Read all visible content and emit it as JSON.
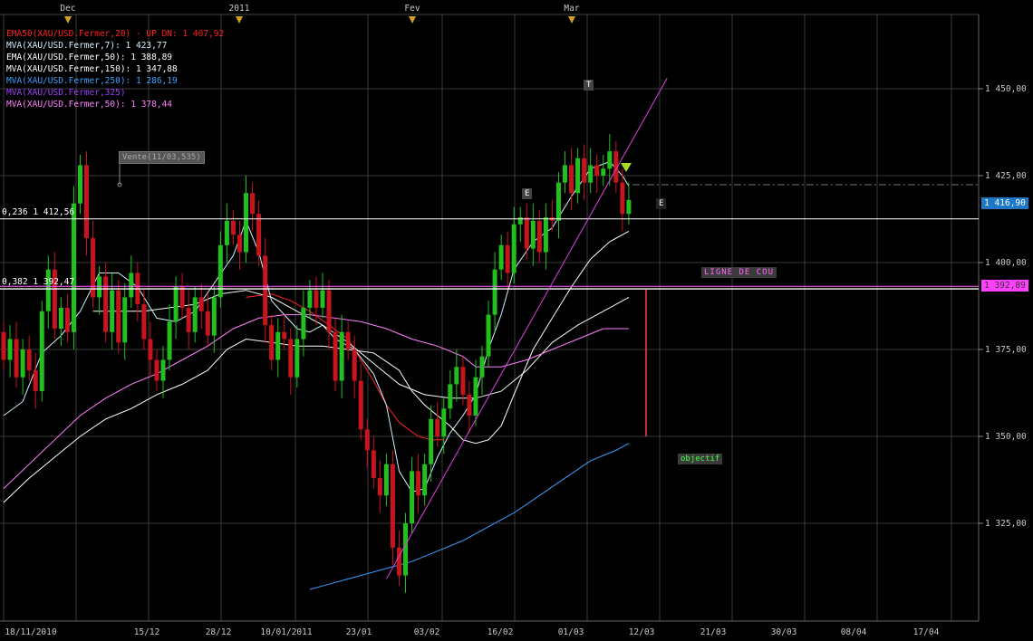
{
  "colors": {
    "background": "#000000",
    "grid": "#3a3a3a",
    "candle_up": "#22c01e",
    "candle_down": "#c8141e",
    "fib_line": "#ffffff",
    "neckline": "#ff66ff",
    "trendline": "#e040e0",
    "ema20": "#ff2020",
    "mva7": "#d0f0ff",
    "ema50": "#f0fff0",
    "mva150": "#ffffff",
    "mva250": "#3aa0ff",
    "mva325": "#9a40ff",
    "mva50": "#ff80ff"
  },
  "legend": [
    {
      "text": "EMA50(XAU/USD.Fermer,20) - UP DN: 1 407,92",
      "color": "#ff2020",
      "name": "legend-ema20"
    },
    {
      "text": "MVA(XAU/USD.Fermer,7): 1 423,77",
      "color": "#d0f0ff",
      "name": "legend-mva7"
    },
    {
      "text": "EMA(XAU/USD.Fermer,50): 1 388,89",
      "color": "#ffffff",
      "name": "legend-ema50"
    },
    {
      "text": "MVA(XAU/USD.Fermer,150): 1 347,88",
      "color": "#ffffff",
      "name": "legend-mva150"
    },
    {
      "text": "MVA(XAU/USD.Fermer,250): 1 286,19",
      "color": "#3aa0ff",
      "name": "legend-mva250"
    },
    {
      "text": "MVA(XAU/USD.Fermer,325)",
      "color": "#9a40ff",
      "name": "legend-mva325"
    },
    {
      "text": "MVA(XAU/USD.Fermer,50): 1 378,44",
      "color": "#ff80ff",
      "name": "legend-mva50"
    }
  ],
  "annotations": {
    "vente": "Vente(11/03,535)",
    "t_marker": "T",
    "e_left": "E",
    "e_right": "E",
    "neckline_label": "LIGNE DE COU",
    "objectif": "objectif",
    "fib_236": "0,236 1 412,56",
    "fib_382": "0,382 1 392,47",
    "last_price": "1 416,90",
    "neck_price": "1 392,89"
  },
  "chart_data": {
    "type": "candlestick",
    "title": "",
    "xlabel": "",
    "ylabel": "",
    "ylim": [
      1297,
      1480
    ],
    "y_ticks": [
      {
        "value": 1450,
        "label": "1 450,00"
      },
      {
        "value": 1425,
        "label": "1 425,00"
      },
      {
        "value": 1400,
        "label": "1 400,00"
      },
      {
        "value": 1375,
        "label": "1 375,00"
      },
      {
        "value": 1350,
        "label": "1 350,00"
      },
      {
        "value": 1325,
        "label": "1 325,00"
      }
    ],
    "x_ticks": [
      "18/11/2010",
      "15/12",
      "28/12",
      "10/01/2011",
      "23/01",
      "03/02",
      "16/02",
      "01/03",
      "12/03",
      "21/03",
      "30/03",
      "08/04",
      "17/04"
    ],
    "month_ticks": [
      "Dec",
      "2011",
      "Fev",
      "Mar"
    ],
    "fib_levels": [
      {
        "ratio": 0.236,
        "value": 1412.56
      },
      {
        "ratio": 0.382,
        "value": 1392.47
      }
    ],
    "neckline": 1392.89,
    "last_price": 1416.9,
    "objective": 1350,
    "candles": [
      [
        1380,
        1372
      ],
      [
        1372,
        1378
      ],
      [
        1378,
        1367
      ],
      [
        1367,
        1375
      ],
      [
        1375,
        1369
      ],
      [
        1369,
        1363
      ],
      [
        1363,
        1386
      ],
      [
        1386,
        1398
      ],
      [
        1398,
        1381
      ],
      [
        1381,
        1387
      ],
      [
        1387,
        1380
      ],
      [
        1380,
        1417
      ],
      [
        1417,
        1428
      ],
      [
        1428,
        1407
      ],
      [
        1407,
        1390
      ],
      [
        1390,
        1396
      ],
      [
        1396,
        1380
      ],
      [
        1380,
        1392
      ],
      [
        1392,
        1377
      ],
      [
        1377,
        1390
      ],
      [
        1390,
        1397
      ],
      [
        1397,
        1388
      ],
      [
        1388,
        1378
      ],
      [
        1378,
        1372
      ],
      [
        1372,
        1366
      ],
      [
        1366,
        1372
      ],
      [
        1372,
        1383
      ],
      [
        1383,
        1393
      ],
      [
        1393,
        1387
      ],
      [
        1387,
        1380
      ],
      [
        1380,
        1390
      ],
      [
        1390,
        1386
      ],
      [
        1386,
        1379
      ],
      [
        1379,
        1390
      ],
      [
        1390,
        1405
      ],
      [
        1405,
        1412
      ],
      [
        1412,
        1408
      ],
      [
        1408,
        1403
      ],
      [
        1403,
        1420
      ],
      [
        1420,
        1414
      ],
      [
        1414,
        1402
      ],
      [
        1402,
        1382
      ],
      [
        1382,
        1372
      ],
      [
        1372,
        1380
      ],
      [
        1380,
        1378
      ],
      [
        1378,
        1367
      ],
      [
        1367,
        1378
      ],
      [
        1378,
        1387
      ],
      [
        1387,
        1392
      ],
      [
        1392,
        1387
      ],
      [
        1387,
        1392
      ],
      [
        1392,
        1380
      ],
      [
        1380,
        1366
      ],
      [
        1366,
        1380
      ],
      [
        1380,
        1375
      ],
      [
        1375,
        1366
      ],
      [
        1366,
        1352
      ],
      [
        1352,
        1346
      ],
      [
        1346,
        1338
      ],
      [
        1338,
        1333
      ],
      [
        1333,
        1342
      ],
      [
        1342,
        1318
      ],
      [
        1318,
        1310
      ],
      [
        1310,
        1325
      ],
      [
        1325,
        1340
      ],
      [
        1340,
        1333
      ],
      [
        1333,
        1342
      ],
      [
        1342,
        1355
      ],
      [
        1355,
        1350
      ],
      [
        1350,
        1358
      ],
      [
        1358,
        1365
      ],
      [
        1365,
        1370
      ],
      [
        1370,
        1362
      ],
      [
        1362,
        1356
      ],
      [
        1356,
        1367
      ],
      [
        1367,
        1373
      ],
      [
        1373,
        1385
      ],
      [
        1385,
        1398
      ],
      [
        1398,
        1405
      ],
      [
        1405,
        1397
      ],
      [
        1397,
        1411
      ],
      [
        1411,
        1413
      ],
      [
        1413,
        1404
      ],
      [
        1404,
        1412
      ],
      [
        1412,
        1403
      ],
      [
        1403,
        1413
      ],
      [
        1413,
        1412
      ],
      [
        1412,
        1423
      ],
      [
        1423,
        1428
      ],
      [
        1428,
        1420
      ],
      [
        1420,
        1430
      ],
      [
        1430,
        1423
      ],
      [
        1423,
        1428
      ],
      [
        1428,
        1425
      ],
      [
        1425,
        1427
      ],
      [
        1427,
        1432
      ],
      [
        1432,
        1423
      ],
      [
        1423,
        1414
      ],
      [
        1414,
        1418
      ]
    ],
    "series": [
      {
        "name": "EMA50(XAU/USD.Fermer,20)",
        "key": "ema20",
        "points": [
          [
            38,
            1390
          ],
          [
            42,
            1391
          ],
          [
            45,
            1389
          ],
          [
            48,
            1386
          ],
          [
            51,
            1382
          ],
          [
            54,
            1378
          ],
          [
            56,
            1372
          ],
          [
            58,
            1366
          ],
          [
            60,
            1359
          ],
          [
            62,
            1354
          ],
          [
            65,
            1350
          ],
          [
            67,
            1349
          ],
          [
            69,
            1349
          ]
        ]
      },
      {
        "name": "MVA(XAU/USD.Fermer,7)",
        "key": "mva7",
        "points": [
          [
            0,
            1356
          ],
          [
            3,
            1360
          ],
          [
            6,
            1374
          ],
          [
            9,
            1379
          ],
          [
            12,
            1386
          ],
          [
            15,
            1397
          ],
          [
            18,
            1397
          ],
          [
            21,
            1393
          ],
          [
            24,
            1384
          ],
          [
            27,
            1383
          ],
          [
            30,
            1386
          ],
          [
            33,
            1394
          ],
          [
            36,
            1402
          ],
          [
            38,
            1412
          ],
          [
            40,
            1403
          ],
          [
            42,
            1389
          ],
          [
            44,
            1385
          ],
          [
            46,
            1381
          ],
          [
            48,
            1380
          ],
          [
            50,
            1382
          ],
          [
            52,
            1378
          ],
          [
            55,
            1375
          ],
          [
            58,
            1368
          ],
          [
            60,
            1359
          ],
          [
            62,
            1340
          ],
          [
            64,
            1334
          ],
          [
            66,
            1335
          ],
          [
            68,
            1344
          ],
          [
            70,
            1351
          ],
          [
            72,
            1356
          ],
          [
            74,
            1362
          ],
          [
            76,
            1375
          ],
          [
            78,
            1385
          ],
          [
            80,
            1398
          ],
          [
            83,
            1406
          ],
          [
            86,
            1410
          ],
          [
            89,
            1419
          ],
          [
            92,
            1427
          ],
          [
            95,
            1429
          ],
          [
            97,
            1425
          ],
          [
            98,
            1422
          ]
        ]
      },
      {
        "name": "EMA(XAU/USD.Fermer,50)",
        "key": "ema50",
        "points": [
          [
            14,
            1386
          ],
          [
            18,
            1386
          ],
          [
            22,
            1386
          ],
          [
            26,
            1387
          ],
          [
            30,
            1388
          ],
          [
            34,
            1391
          ],
          [
            38,
            1392
          ],
          [
            42,
            1390
          ],
          [
            46,
            1386
          ],
          [
            50,
            1382
          ],
          [
            54,
            1377
          ],
          [
            58,
            1371
          ],
          [
            62,
            1365
          ],
          [
            66,
            1362
          ],
          [
            70,
            1361
          ],
          [
            74,
            1361
          ],
          [
            78,
            1363
          ],
          [
            82,
            1369
          ],
          [
            86,
            1377
          ],
          [
            90,
            1382
          ],
          [
            94,
            1386
          ],
          [
            98,
            1390
          ]
        ]
      },
      {
        "name": "MVA(XAU/USD.Fermer,150)",
        "key": "mva150",
        "points": [
          [
            0,
            1331
          ],
          [
            4,
            1338
          ],
          [
            8,
            1344
          ],
          [
            12,
            1350
          ],
          [
            16,
            1355
          ],
          [
            20,
            1358
          ],
          [
            24,
            1362
          ],
          [
            28,
            1365
          ],
          [
            32,
            1369
          ],
          [
            35,
            1375
          ],
          [
            38,
            1378
          ],
          [
            42,
            1377
          ],
          [
            46,
            1376
          ],
          [
            50,
            1376
          ],
          [
            54,
            1375
          ],
          [
            58,
            1374
          ],
          [
            62,
            1369
          ],
          [
            64,
            1363
          ],
          [
            66,
            1359
          ],
          [
            70,
            1353
          ],
          [
            72,
            1349
          ],
          [
            74,
            1348
          ],
          [
            76,
            1349
          ],
          [
            78,
            1353
          ],
          [
            80,
            1362
          ],
          [
            83,
            1375
          ],
          [
            86,
            1384
          ],
          [
            89,
            1393
          ],
          [
            92,
            1401
          ],
          [
            95,
            1406
          ],
          [
            98,
            1409
          ]
        ]
      },
      {
        "name": "MVA(XAU/USD.Fermer,250)",
        "key": "mva250",
        "points": [
          [
            48,
            1306
          ],
          [
            52,
            1308
          ],
          [
            56,
            1310
          ],
          [
            60,
            1312
          ],
          [
            64,
            1314
          ],
          [
            68,
            1317
          ],
          [
            72,
            1320
          ],
          [
            76,
            1324
          ],
          [
            80,
            1328
          ],
          [
            84,
            1333
          ],
          [
            88,
            1338
          ],
          [
            92,
            1343
          ],
          [
            96,
            1346
          ],
          [
            98,
            1348
          ]
        ]
      },
      {
        "name": "MVA(XAU/USD.Fermer,50)",
        "key": "mva50",
        "points": [
          [
            0,
            1335
          ],
          [
            4,
            1342
          ],
          [
            8,
            1349
          ],
          [
            12,
            1356
          ],
          [
            16,
            1361
          ],
          [
            20,
            1365
          ],
          [
            24,
            1368
          ],
          [
            28,
            1372
          ],
          [
            32,
            1376
          ],
          [
            36,
            1381
          ],
          [
            40,
            1384
          ],
          [
            44,
            1385
          ],
          [
            48,
            1385
          ],
          [
            52,
            1384
          ],
          [
            56,
            1383
          ],
          [
            60,
            1381
          ],
          [
            64,
            1378
          ],
          [
            68,
            1376
          ],
          [
            72,
            1373
          ],
          [
            74,
            1370
          ],
          [
            78,
            1370
          ],
          [
            82,
            1372
          ],
          [
            86,
            1375
          ],
          [
            90,
            1378
          ],
          [
            94,
            1381
          ],
          [
            98,
            1381
          ]
        ]
      }
    ],
    "trendline": [
      [
        60,
        1309
      ],
      [
        104,
        1453
      ]
    ]
  }
}
